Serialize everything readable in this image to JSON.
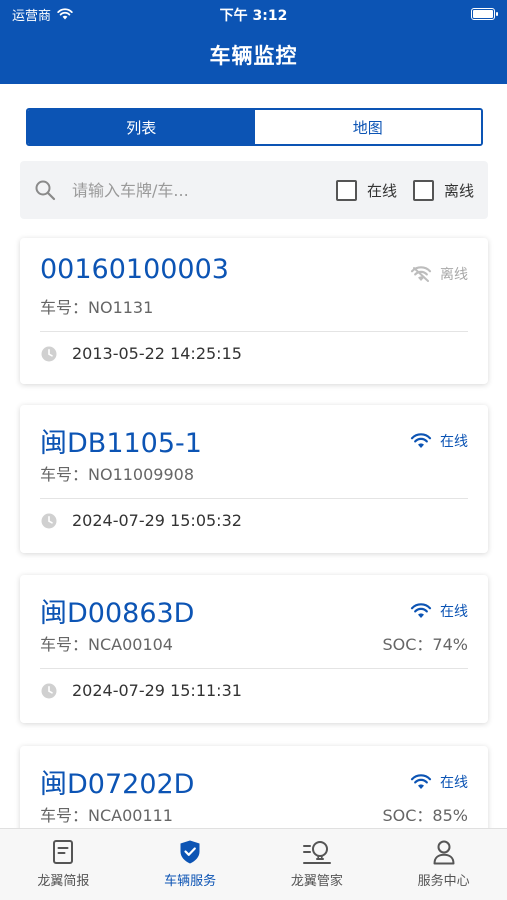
{
  "status_bar": {
    "carrier": "运营商",
    "time": "下午 3:12"
  },
  "header": {
    "title": "车辆监控"
  },
  "segment": {
    "list_label": "列表",
    "map_label": "地图"
  },
  "search": {
    "placeholder": "请输入车牌/车...",
    "online_label": "在线",
    "offline_label": "离线"
  },
  "vehicles": [
    {
      "plate": "00160100003",
      "status": "离线",
      "car_no": "车号：NO1131",
      "soc": "",
      "time": "2013-05-22 14:25:15"
    },
    {
      "plate": "闽DB1105-1",
      "status": "在线",
      "car_no": "车号：NO11009908",
      "soc": "",
      "time": "2024-07-29 15:05:32"
    },
    {
      "plate": "闽D00863D",
      "status": "在线",
      "car_no": "车号：NCA00104",
      "soc": "SOC：74%",
      "time": "2024-07-29 15:11:31"
    },
    {
      "plate": "闽D07202D",
      "status": "在线",
      "car_no": "车号：NCA00111",
      "soc": "SOC：85%",
      "time": ""
    }
  ],
  "tabbar": {
    "items": [
      {
        "label": "龙翼简报",
        "icon": "document-icon"
      },
      {
        "label": "车辆服务",
        "icon": "shield-check-icon"
      },
      {
        "label": "龙翼管家",
        "icon": "lightbulb-icon"
      },
      {
        "label": "服务中心",
        "icon": "user-icon"
      }
    ],
    "active_index": 1
  },
  "colors": {
    "primary": "#0c54b4",
    "offline_gray": "#a8a8a8"
  }
}
